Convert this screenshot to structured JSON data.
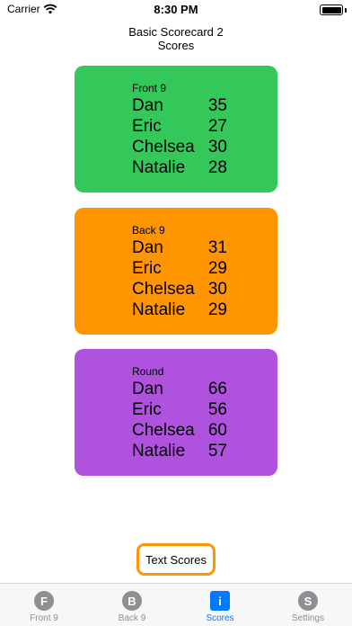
{
  "status_bar": {
    "carrier": "Carrier",
    "time": "8:30 PM"
  },
  "nav": {
    "title_line1": "Basic Scorecard 2",
    "title_line2": "Scores"
  },
  "cards": {
    "front": {
      "title": "Front 9",
      "color": "#34c759",
      "rows": [
        {
          "name": "Dan",
          "score": "35"
        },
        {
          "name": "Eric",
          "score": "27"
        },
        {
          "name": "Chelsea",
          "score": "30"
        },
        {
          "name": "Natalie",
          "score": "28"
        }
      ]
    },
    "back": {
      "title": "Back 9",
      "color": "#ff9500",
      "rows": [
        {
          "name": "Dan",
          "score": "31"
        },
        {
          "name": "Eric",
          "score": "29"
        },
        {
          "name": "Chelsea",
          "score": "30"
        },
        {
          "name": "Natalie",
          "score": "29"
        }
      ]
    },
    "round": {
      "title": "Round",
      "color": "#af52de",
      "rows": [
        {
          "name": "Dan",
          "score": "66"
        },
        {
          "name": "Eric",
          "score": "56"
        },
        {
          "name": "Chelsea",
          "score": "60"
        },
        {
          "name": "Natalie",
          "score": "57"
        }
      ]
    }
  },
  "text_scores_button": {
    "label": "Text Scores",
    "border_color": "#ff9500"
  },
  "tabs": [
    {
      "icon_letter": "F",
      "icon": "f-circle-icon",
      "label": "Front 9"
    },
    {
      "icon_letter": "B",
      "icon": "b-circle-icon",
      "label": "Back 9"
    },
    {
      "icon_letter": "i",
      "icon": "info-square-icon",
      "label": "Scores",
      "active": true
    },
    {
      "icon_letter": "S",
      "icon": "s-circle-icon",
      "label": "Settings"
    }
  ],
  "accent_color": "#007aff"
}
